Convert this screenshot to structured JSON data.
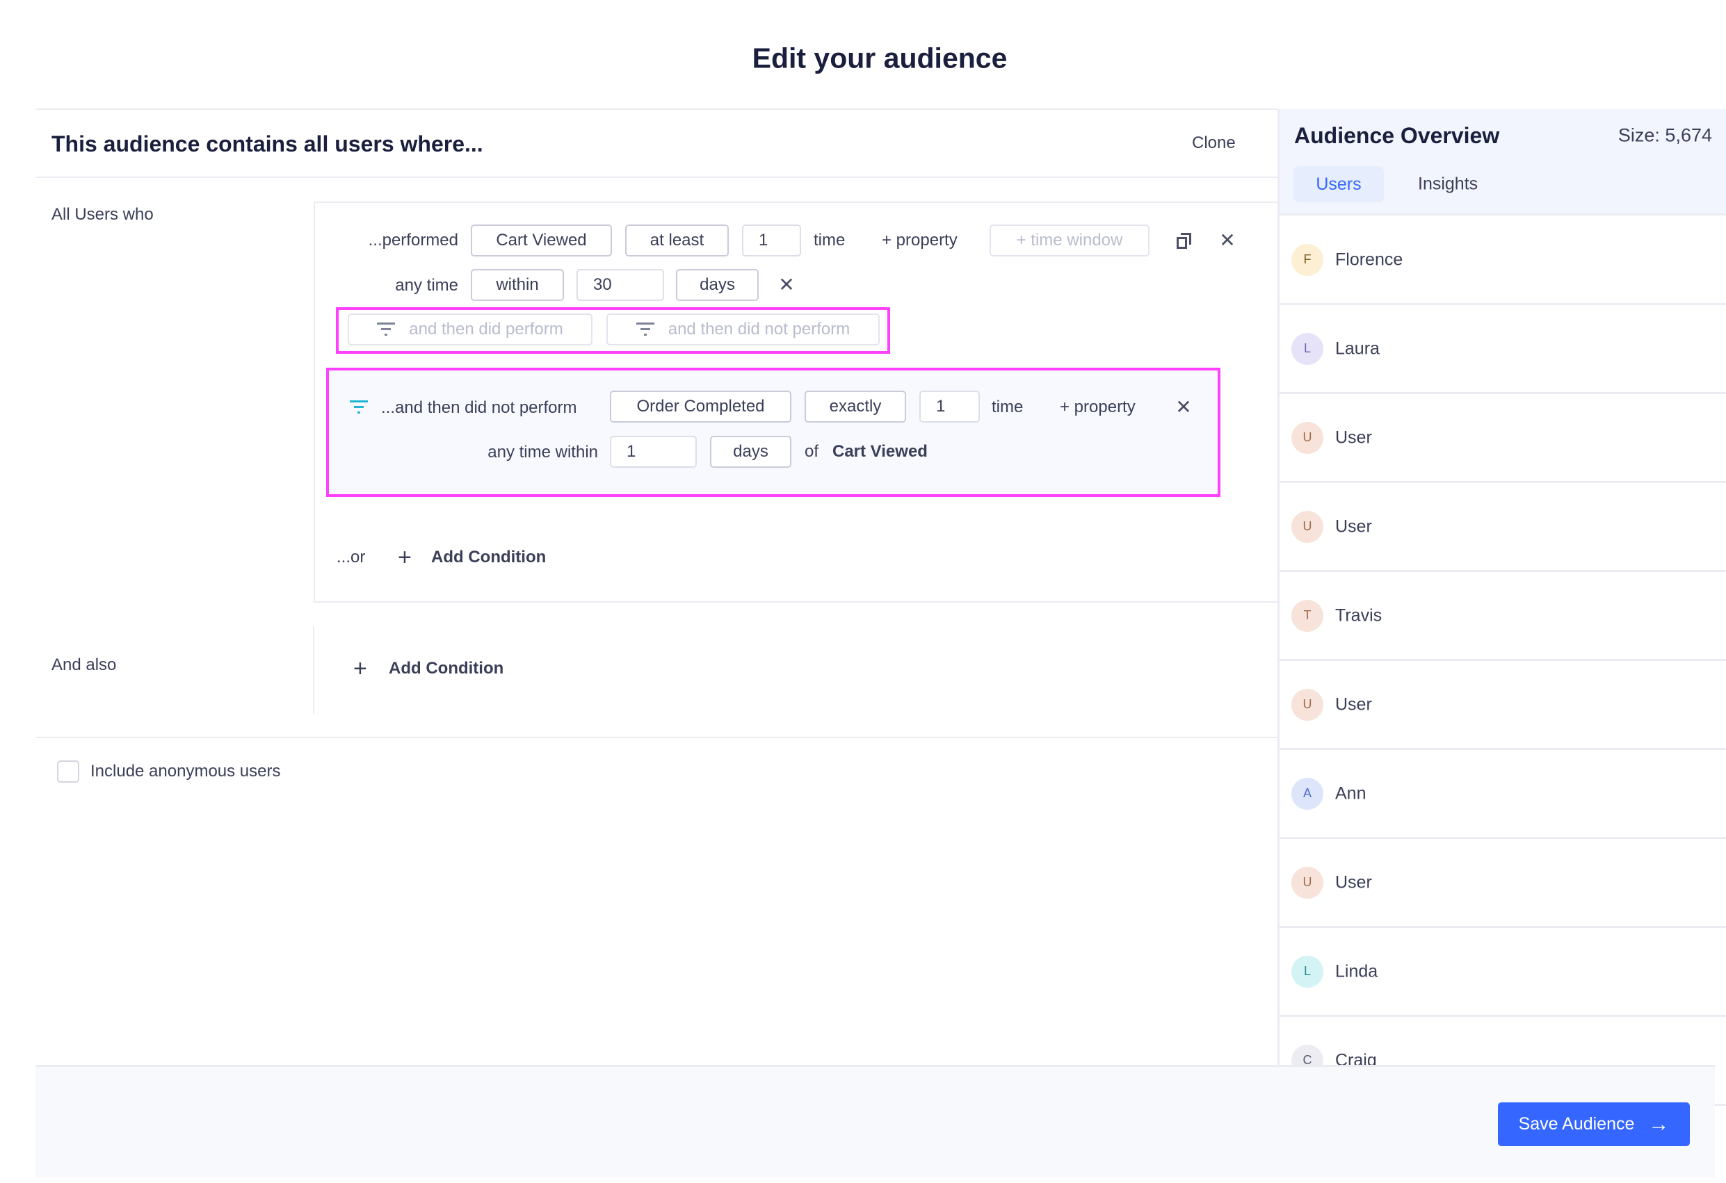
{
  "page_title": "Edit your audience",
  "builder": {
    "header": "This audience contains all users where...",
    "clone_label": "Clone",
    "all_users_label": "All Users who",
    "condition": {
      "performed_label": "...performed",
      "event": "Cart Viewed",
      "operator": "at least",
      "count": "1",
      "time_label": "time",
      "add_property": "+ property",
      "time_window": "+ time window",
      "anytime_label": "any time",
      "within": "within",
      "within_value": "30",
      "unit": "days",
      "then_did_perform": "and then did perform",
      "then_did_not_perform": "and then did not perform"
    },
    "sub_condition": {
      "label": "...and then did not perform",
      "event": "Order Completed",
      "operator": "exactly",
      "count": "1",
      "time_label": "time",
      "add_property": "+ property",
      "within_label": "any time within",
      "within_value": "1",
      "unit": "days",
      "of_label": "of",
      "ref_event": "Cart Viewed"
    },
    "or_label": "...or",
    "add_condition": "Add Condition",
    "and_also_label": "And also",
    "include_anonymous": "Include anonymous users",
    "include_anonymous_checked": false
  },
  "overview": {
    "title": "Audience Overview",
    "size": "Size: 5,674",
    "tabs": [
      {
        "label": "Users",
        "active": true
      },
      {
        "label": "Insights",
        "active": false
      }
    ],
    "users": [
      {
        "initial": "F",
        "name": "Florence",
        "bg": "#fdefd3",
        "fg": "#7a5a1e"
      },
      {
        "initial": "L",
        "name": "Laura",
        "bg": "#e6e3f8",
        "fg": "#6b5fb5"
      },
      {
        "initial": "U",
        "name": "User",
        "bg": "#f7e3d9",
        "fg": "#a06a4a"
      },
      {
        "initial": "U",
        "name": "User",
        "bg": "#f7e3d9",
        "fg": "#a06a4a"
      },
      {
        "initial": "T",
        "name": "Travis",
        "bg": "#f7e3d9",
        "fg": "#a06a4a"
      },
      {
        "initial": "U",
        "name": "User",
        "bg": "#f7e3d9",
        "fg": "#a06a4a"
      },
      {
        "initial": "A",
        "name": "Ann",
        "bg": "#dde5fb",
        "fg": "#4a6ad0"
      },
      {
        "initial": "U",
        "name": "User",
        "bg": "#f7e3d9",
        "fg": "#a06a4a"
      },
      {
        "initial": "L",
        "name": "Linda",
        "bg": "#d3f3f5",
        "fg": "#2a8a90"
      },
      {
        "initial": "C",
        "name": "Craig",
        "bg": "#ececf2",
        "fg": "#555a70"
      }
    ]
  },
  "footer": {
    "save_label": "Save Audience"
  },
  "colors": {
    "accent": "#3566ff",
    "highlight": "#ff40ff",
    "filter_icon": "#1fb6d4"
  }
}
